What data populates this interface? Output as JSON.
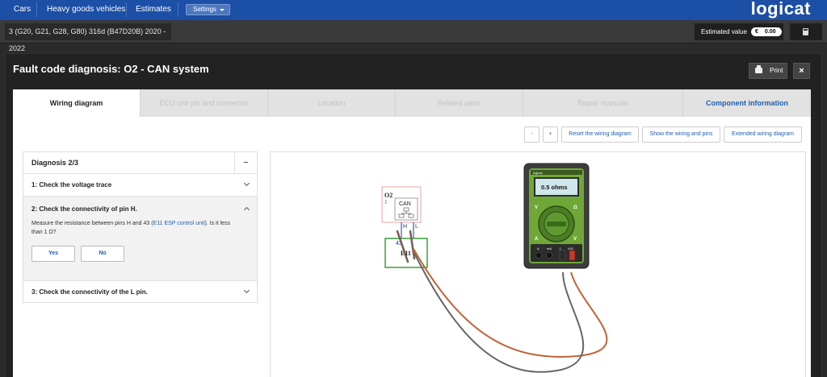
{
  "nav": {
    "items": [
      "Cars",
      "Heavy goods vehicles",
      "Estimates"
    ],
    "settings_label": "Settings",
    "logo_text": "logicat"
  },
  "vehicle": {
    "label": "3 (G20, G21, G28, G80) 316d (B47D20B) 2020 - 2022",
    "estimated_label": "Estimated value",
    "estimated_currency": "€",
    "estimated_amount": "0.00"
  },
  "modal": {
    "title": "Fault code diagnosis: O2 - CAN system",
    "print_label": "Print",
    "close_label": "×"
  },
  "tabs": [
    {
      "label": "Wiring diagram",
      "state": "active"
    },
    {
      "label": "ECU unit pin and connector",
      "state": "disabled"
    },
    {
      "label": "Location",
      "state": "disabled"
    },
    {
      "label": "Related parts",
      "state": "disabled"
    },
    {
      "label": "Repair manuals",
      "state": "disabled"
    },
    {
      "label": "Component information",
      "state": "link"
    }
  ],
  "toolbar": {
    "zoom_out": "-",
    "zoom_in": "+",
    "reset": "Reset the wiring diagram",
    "show_wiring": "Show the wiring and pins",
    "extended": "Extended wiring diagram"
  },
  "diagnosis": {
    "title": "Diagnosis 2/3",
    "toggle": "−",
    "steps": [
      {
        "title": "1: Check the voltage trace"
      },
      {
        "title": "2: Check the connectivity of pin H.",
        "text_before": "Measure the resistance between pins H and 43 (",
        "link": "E11 ESP control unit",
        "text_after": "). Is it less than 1 Ω?",
        "yes": "Yes",
        "no": "No"
      },
      {
        "title": "3: Check the connectivity of the L pin."
      }
    ]
  },
  "diagram": {
    "o2_label": "O2",
    "o2_pin": "1",
    "can_label": "CAN",
    "pin_h": "H",
    "pin_l": "L",
    "pin_43": "43",
    "ecu_label": "E11",
    "meter_brand": "logicat",
    "meter_reading": "0.5 ohms",
    "dial_v_left": "V",
    "dial_omega": "Ω",
    "dial_v_right": "V",
    "dial_a": "A",
    "jack_a": "A",
    "jack_ma": "mA",
    "jack_com": "⊥",
    "jack_v": "V/Ω"
  }
}
